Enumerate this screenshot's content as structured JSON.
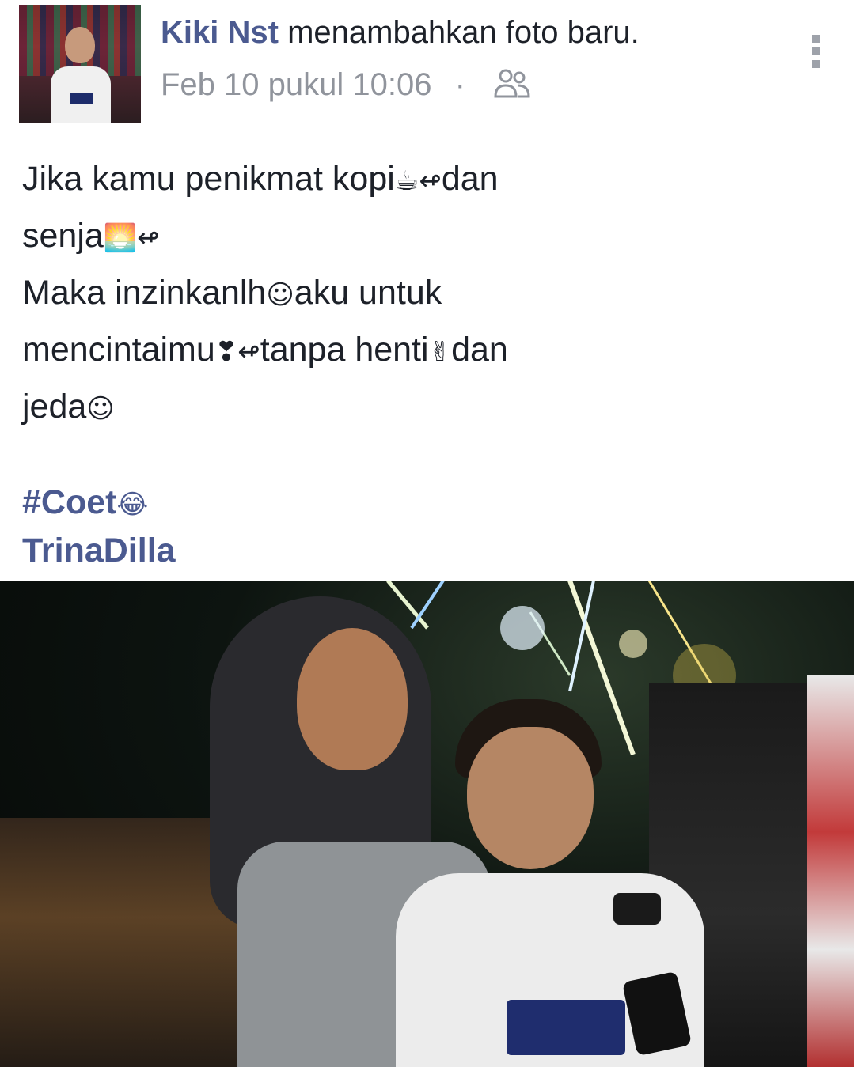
{
  "post": {
    "author": "Kiki Nst",
    "action": "menambahkan foto baru.",
    "timestamp": "Feb 10 pukul 10:06",
    "separator": "·",
    "privacy_icon": "friends-icon",
    "menu_icon": "more-vertical-icon",
    "text_lines": [
      {
        "text": "Jika kamu penikmat kopi",
        "emoji": "☕",
        "arrow": "↫",
        "tail": "dan"
      },
      {
        "text": "senja",
        "emoji": "🌅",
        "arrow": "↫",
        "tail": ""
      },
      {
        "text": "Maka inzinkanlh",
        "emoji": "☺",
        "arrow": "",
        "tail": "aku untuk"
      },
      {
        "text": "mencintaimu",
        "emoji": "❣",
        "arrow": "↫",
        "tail": "tanpa henti",
        "emoji2": "✌",
        "tail2": "dan"
      },
      {
        "text": "jeda",
        "emoji": "☺",
        "arrow": "",
        "tail": ""
      }
    ],
    "hashtag": "#Coet",
    "hashtag_emoji": "😂",
    "tagged_name": "TrinaDilla",
    "photo_description_icon": "post-photo"
  },
  "colors": {
    "link": "#4b5a90",
    "text": "#1d2129",
    "meta": "#90949c"
  }
}
